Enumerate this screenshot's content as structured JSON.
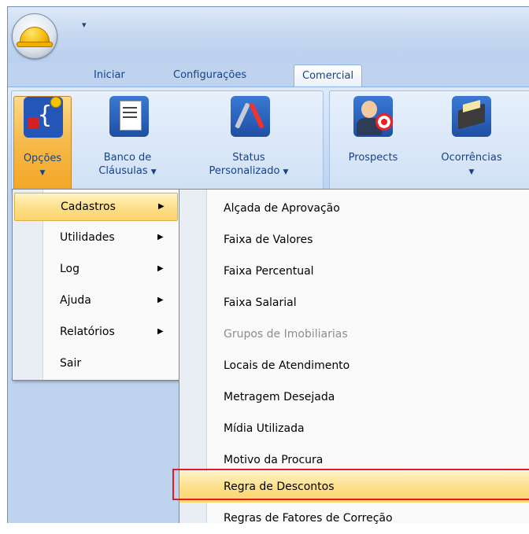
{
  "quick_access": {
    "customize_icon": "chevron-down"
  },
  "tabs": [
    {
      "label": "Iniciar"
    },
    {
      "label": "Configurações"
    },
    {
      "label": "Comercial"
    }
  ],
  "ribbon": {
    "buttons": [
      {
        "line1": "Opções",
        "icon": "options-icon"
      },
      {
        "line1": "Banco de",
        "line2": "Cláusulas",
        "icon": "clauses-icon"
      },
      {
        "line1": "Status",
        "line2": "Personalizado",
        "icon": "status-icon"
      },
      {
        "line1": "Prospects",
        "icon": "prospects-icon"
      },
      {
        "line1": "Ocorrências",
        "icon": "occurrences-icon"
      }
    ]
  },
  "menu": {
    "items": [
      {
        "label": "Cadastros",
        "has_submenu": true
      },
      {
        "label": "Utilidades",
        "has_submenu": true
      },
      {
        "label": "Log",
        "has_submenu": true
      },
      {
        "label": "Ajuda",
        "has_submenu": true
      },
      {
        "label": "Relatórios",
        "has_submenu": true
      },
      {
        "label": "Sair",
        "has_submenu": false
      }
    ]
  },
  "submenu": {
    "items": [
      {
        "label": "Alçada de Aprovação"
      },
      {
        "label": "Faixa de Valores"
      },
      {
        "label": "Faixa Percentual"
      },
      {
        "label": "Faixa Salarial"
      },
      {
        "label": "Grupos de Imobiliarias",
        "disabled": true
      },
      {
        "label": "Locais de Atendimento"
      },
      {
        "label": "Metragem Desejada"
      },
      {
        "label": "Mídia Utilizada"
      },
      {
        "label": "Motivo da Procura"
      },
      {
        "label": "Regra de Descontos",
        "highlighted": true
      },
      {
        "label": "Regras de Fatores de Correção"
      }
    ]
  },
  "colors": {
    "highlight_box": "#e31b23",
    "menu_hover": "#fde08c"
  }
}
